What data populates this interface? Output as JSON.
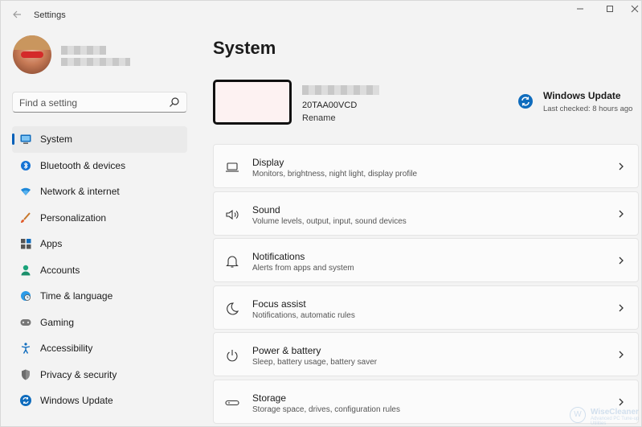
{
  "titlebar": {
    "back_icon": "arrow-left-icon",
    "title": "Settings",
    "controls": [
      "minimize-icon",
      "maximize-icon",
      "close-icon"
    ]
  },
  "search": {
    "placeholder": "Find a setting"
  },
  "sidebar": {
    "items": [
      {
        "label": "System",
        "icon": "monitor-icon",
        "active": true
      },
      {
        "label": "Bluetooth & devices",
        "icon": "bluetooth-icon"
      },
      {
        "label": "Network & internet",
        "icon": "wifi-icon"
      },
      {
        "label": "Personalization",
        "icon": "brush-icon"
      },
      {
        "label": "Apps",
        "icon": "apps-grid-icon"
      },
      {
        "label": "Accounts",
        "icon": "person-icon"
      },
      {
        "label": "Time & language",
        "icon": "globe-clock-icon"
      },
      {
        "label": "Gaming",
        "icon": "gamepad-icon"
      },
      {
        "label": "Accessibility",
        "icon": "accessibility-icon"
      },
      {
        "label": "Privacy & security",
        "icon": "shield-icon"
      },
      {
        "label": "Windows Update",
        "icon": "sync-icon"
      }
    ]
  },
  "main": {
    "title": "System",
    "device": {
      "model": "20TAA00VCD",
      "rename_label": "Rename"
    },
    "windows_update": {
      "title": "Windows Update",
      "status": "Last checked: 8 hours ago"
    },
    "cards": [
      {
        "title": "Display",
        "subtitle": "Monitors, brightness, night light, display profile",
        "icon": "laptop-icon"
      },
      {
        "title": "Sound",
        "subtitle": "Volume levels, output, input, sound devices",
        "icon": "speaker-icon"
      },
      {
        "title": "Notifications",
        "subtitle": "Alerts from apps and system",
        "icon": "bell-icon"
      },
      {
        "title": "Focus assist",
        "subtitle": "Notifications, automatic rules",
        "icon": "moon-icon"
      },
      {
        "title": "Power & battery",
        "subtitle": "Sleep, battery usage, battery saver",
        "icon": "power-icon"
      },
      {
        "title": "Storage",
        "subtitle": "Storage space, drives, configuration rules",
        "icon": "storage-drive-icon"
      }
    ]
  },
  "watermark": {
    "text": "WiseCleaner",
    "sub": "Advanced PC Tune-up Utilities"
  },
  "colors": {
    "accent": "#005fb8",
    "background": "#f3f3f3",
    "card": "#fbfbfb"
  }
}
